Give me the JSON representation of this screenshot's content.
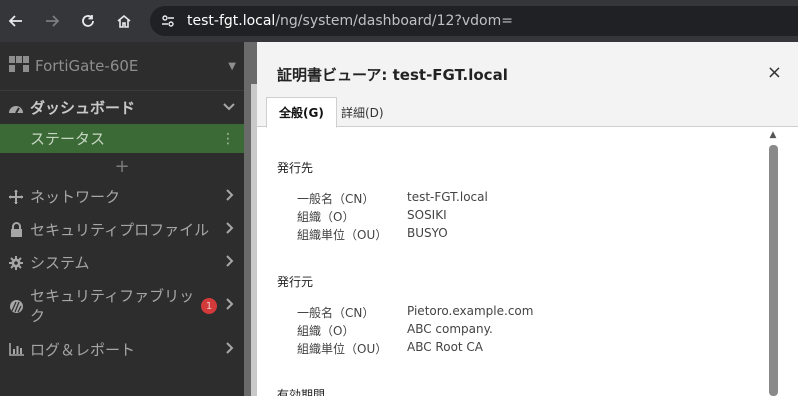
{
  "browser": {
    "url_host": "test-fgt.local",
    "url_path": "/ng/system/dashboard/12?vdom="
  },
  "sidebar": {
    "device_name": "FortiGate-60E",
    "dashboard_label": "ダッシュボード",
    "status_label": "ステータス",
    "add_label": "+",
    "items": [
      {
        "label": "ネットワーク",
        "icon": "network-icon"
      },
      {
        "label": "セキュリティプロファイル",
        "icon": "lock-icon"
      },
      {
        "label": "システム",
        "icon": "gear-icon"
      },
      {
        "label": "セキュリティファブリック",
        "icon": "fabric-icon",
        "badge": "1"
      },
      {
        "label": "ログ＆レポート",
        "icon": "chart-icon"
      }
    ]
  },
  "dialog": {
    "title": "証明書ビューア: test-FGT.local",
    "close": "×",
    "tabs": [
      "全般(G)",
      "詳細(D)"
    ],
    "issued_to": {
      "title": "発行先",
      "fields": [
        {
          "label": "一般名（CN）",
          "value": "test-FGT.local"
        },
        {
          "label": "組織（O）",
          "value": "SOSIKI"
        },
        {
          "label": "組織単位（OU）",
          "value": "BUSYO"
        }
      ]
    },
    "issued_by": {
      "title": "発行元",
      "fields": [
        {
          "label": "一般名（CN）",
          "value": "Pietoro.example.com"
        },
        {
          "label": "組織（O）",
          "value": "ABC company."
        },
        {
          "label": "組織単位（OU）",
          "value": "ABC Root CA"
        }
      ]
    },
    "validity": {
      "title": "有効期間"
    }
  }
}
